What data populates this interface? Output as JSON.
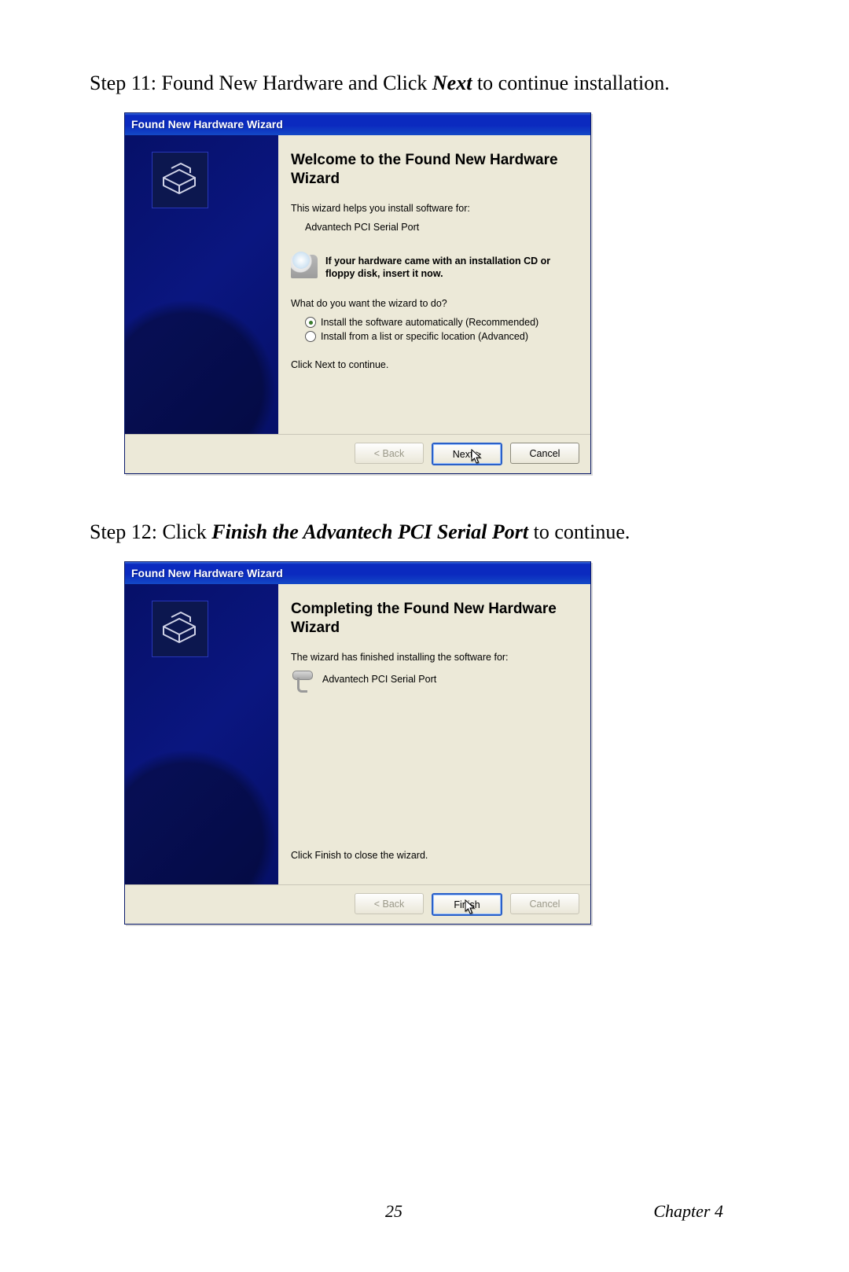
{
  "step11": {
    "prefix": "Step 11: Found New Hardware and Click ",
    "bold": "Next",
    "suffix": " to continue installation."
  },
  "step12": {
    "prefix": "Step 12: Click ",
    "bold": "Finish the Advantech PCI Serial Port",
    "suffix": " to continue."
  },
  "dialog1": {
    "title": "Found New Hardware Wizard",
    "heading": "Welcome to the Found New Hardware Wizard",
    "intro": "This wizard helps you install software for:",
    "device": "Advantech PCI Serial Port",
    "cd_text": "If your hardware came with an installation CD or floppy disk, insert it now.",
    "question": "What do you want the wizard to do?",
    "opt1": "Install the software automatically (Recommended)",
    "opt2": "Install from a list or specific location (Advanced)",
    "click_next": "Click Next to continue.",
    "back": "< Back",
    "next": "Next >",
    "cancel": "Cancel"
  },
  "dialog2": {
    "title": "Found New Hardware Wizard",
    "heading": "Completing the Found New Hardware Wizard",
    "intro": "The wizard has finished installing the software for:",
    "device": "Advantech PCI Serial Port",
    "click_finish": "Click Finish to close the wizard.",
    "back": "< Back",
    "finish": "Finish",
    "cancel": "Cancel"
  },
  "footer": {
    "page": "25",
    "chapter": "Chapter 4"
  }
}
